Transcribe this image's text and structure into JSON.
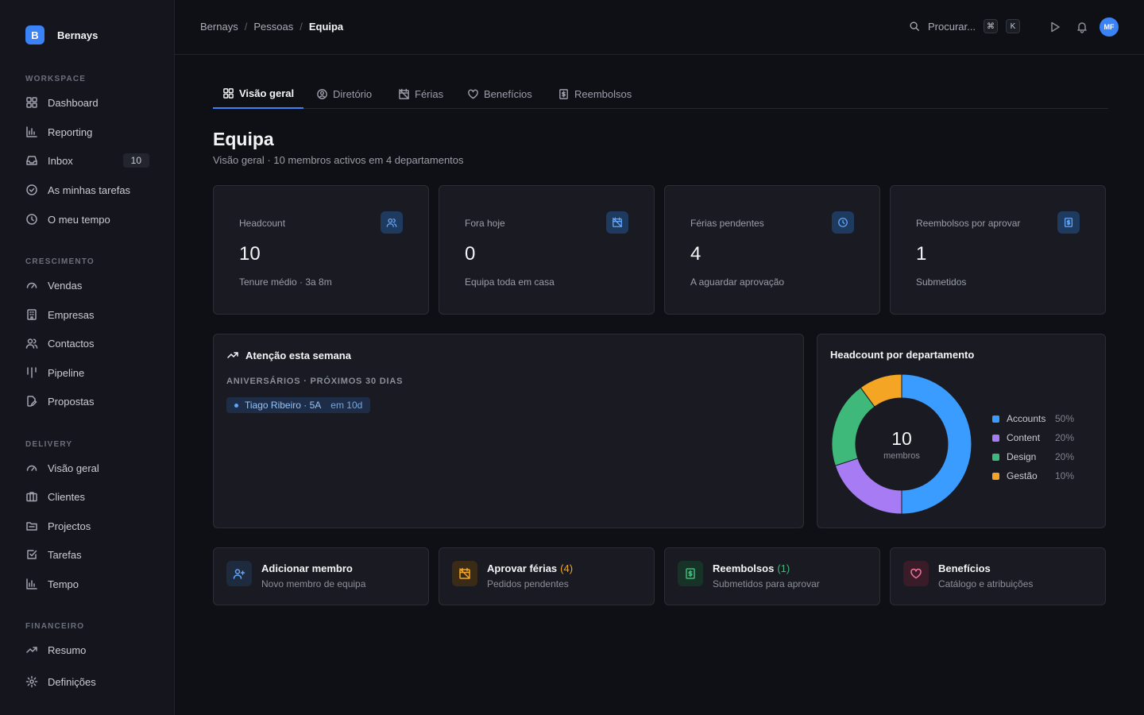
{
  "brand": {
    "logo_letter": "B",
    "name": "Bernays"
  },
  "sidebar": {
    "sections": [
      {
        "label": "WORKSPACE"
      },
      {
        "label": "CRESCIMENTO"
      },
      {
        "label": "DELIVERY"
      },
      {
        "label": "FINANCEIRO"
      }
    ],
    "items": [
      {
        "label": "Dashboard",
        "icon": "grid-icon"
      },
      {
        "label": "Reporting",
        "icon": "bar-chart-icon"
      },
      {
        "label": "Inbox",
        "icon": "inbox-icon",
        "badge": "10"
      },
      {
        "label": "As minhas tarefas",
        "icon": "check-circle-icon"
      },
      {
        "label": "O meu tempo",
        "icon": "clock-icon"
      },
      {
        "label": "Vendas",
        "icon": "gauge-icon"
      },
      {
        "label": "Empresas",
        "icon": "building-icon"
      },
      {
        "label": "Contactos",
        "icon": "users-icon"
      },
      {
        "label": "Pipeline",
        "icon": "pipeline-icon"
      },
      {
        "label": "Propostas",
        "icon": "file-edit-icon"
      },
      {
        "label": "Visão geral",
        "icon": "gauge-icon"
      },
      {
        "label": "Clientes",
        "icon": "briefcase-icon"
      },
      {
        "label": "Projectos",
        "icon": "folder-icon"
      },
      {
        "label": "Tarefas",
        "icon": "checkbox-icon"
      },
      {
        "label": "Tempo",
        "icon": "bar-chart-icon"
      },
      {
        "label": "Resumo",
        "icon": "trend-icon"
      },
      {
        "label": "Definições",
        "icon": "gear-icon"
      }
    ]
  },
  "header": {
    "breadcrumb": [
      "Bernays",
      "Pessoas",
      "Equipa"
    ],
    "search_placeholder": "Procurar...",
    "kbd": [
      "⌘",
      "K"
    ],
    "avatar_initials": "MF"
  },
  "tabs": [
    {
      "label": "Visão geral",
      "active": true
    },
    {
      "label": "Diretório"
    },
    {
      "label": "Férias"
    },
    {
      "label": "Benefícios"
    },
    {
      "label": "Reembolsos"
    }
  ],
  "page": {
    "title": "Equipa",
    "subtitle": "Visão geral · 10 membros activos em 4 departamentos"
  },
  "stats": [
    {
      "label": "Headcount",
      "value": "10",
      "sub": "Tenure médio · 3a 8m",
      "icon": "users-icon"
    },
    {
      "label": "Fora hoje",
      "value": "0",
      "sub": "Equipa toda em casa",
      "icon": "calendar-off-icon"
    },
    {
      "label": "Férias pendentes",
      "value": "4",
      "sub": "A aguardar aprovação",
      "icon": "clock-icon"
    },
    {
      "label": "Reembolsos por aprovar",
      "value": "1",
      "sub": "Submetidos",
      "icon": "receipt-icon"
    }
  ],
  "attention": {
    "title": "Atenção esta semana",
    "subtitle": "ANIVERSÁRIOS · PRÓXIMOS 30 DIAS",
    "items": [
      {
        "name": "Tiago Ribeiro · 5A",
        "when": "em 10d"
      }
    ]
  },
  "headcount_panel": {
    "title": "Headcount por departamento",
    "center_value": "10",
    "center_label": "membros"
  },
  "chart_data": {
    "type": "pie",
    "title": "Headcount por departamento",
    "categories": [
      "Accounts",
      "Content",
      "Design",
      "Gestão"
    ],
    "values": [
      50,
      20,
      20,
      10
    ],
    "labels": [
      "50%",
      "20%",
      "20%",
      "10%"
    ],
    "colors": [
      "#3b9cff",
      "#a77bf3",
      "#3fb97a",
      "#f5a524"
    ],
    "legend": "right"
  },
  "actions": [
    {
      "title": "Adicionar membro",
      "count": "",
      "sub": "Novo membro de equipa",
      "icon": "user-plus-icon",
      "bg": "#1e2a3d",
      "fg": "#60a5fa",
      "count_color": "#60a5fa"
    },
    {
      "title": "Aprovar férias",
      "count": "(4)",
      "sub": "Pedidos pendentes",
      "icon": "calendar-off-icon",
      "bg": "#3a2b17",
      "fg": "#f5a524",
      "count_color": "#f5a524"
    },
    {
      "title": "Reembolsos",
      "count": "(1)",
      "sub": "Submetidos para aprovar",
      "icon": "receipt-icon",
      "bg": "#173226",
      "fg": "#3fb97a",
      "count_color": "#3fb97a"
    },
    {
      "title": "Benefícios",
      "count": "",
      "sub": "Catálogo e atribuições",
      "icon": "heart-icon",
      "bg": "#3a1c28",
      "fg": "#f472a0",
      "count_color": "#f472a0"
    }
  ]
}
